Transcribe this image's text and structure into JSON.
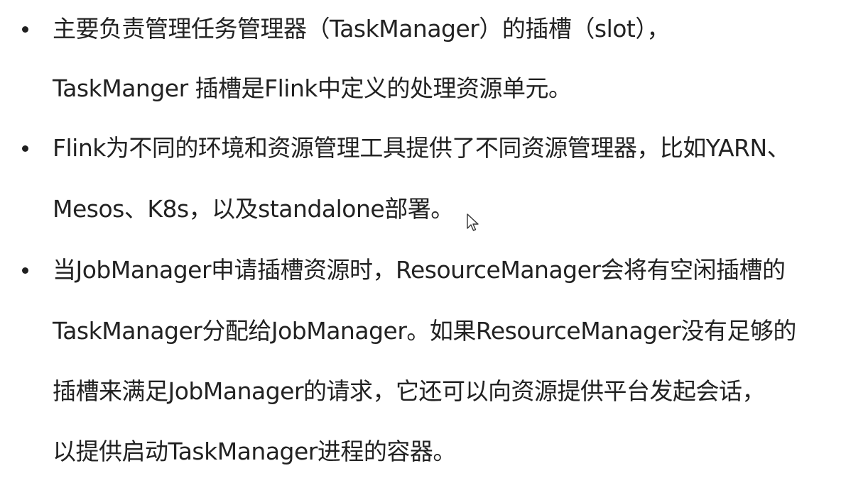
{
  "bullets": [
    {
      "lines": [
        "主要负责管理任务管理器（TaskManager）的插槽（slot），",
        "TaskManger 插槽是Flink中定义的处理资源单元。"
      ]
    },
    {
      "lines": [
        "Flink为不同的环境和资源管理工具提供了不同资源管理器，比如YARN、",
        "Mesos、K8s，以及standalone部署。"
      ]
    },
    {
      "lines": [
        "当JobManager申请插槽资源时，ResourceManager会将有空闲插槽的",
        "TaskManager分配给JobManager。如果ResourceManager没有足够的",
        "插槽来满足JobManager的请求，它还可以向资源提供平台发起会话，",
        "以提供启动TaskManager进程的容器。"
      ]
    }
  ],
  "cursor": {
    "icon": "mouse-pointer-icon"
  }
}
